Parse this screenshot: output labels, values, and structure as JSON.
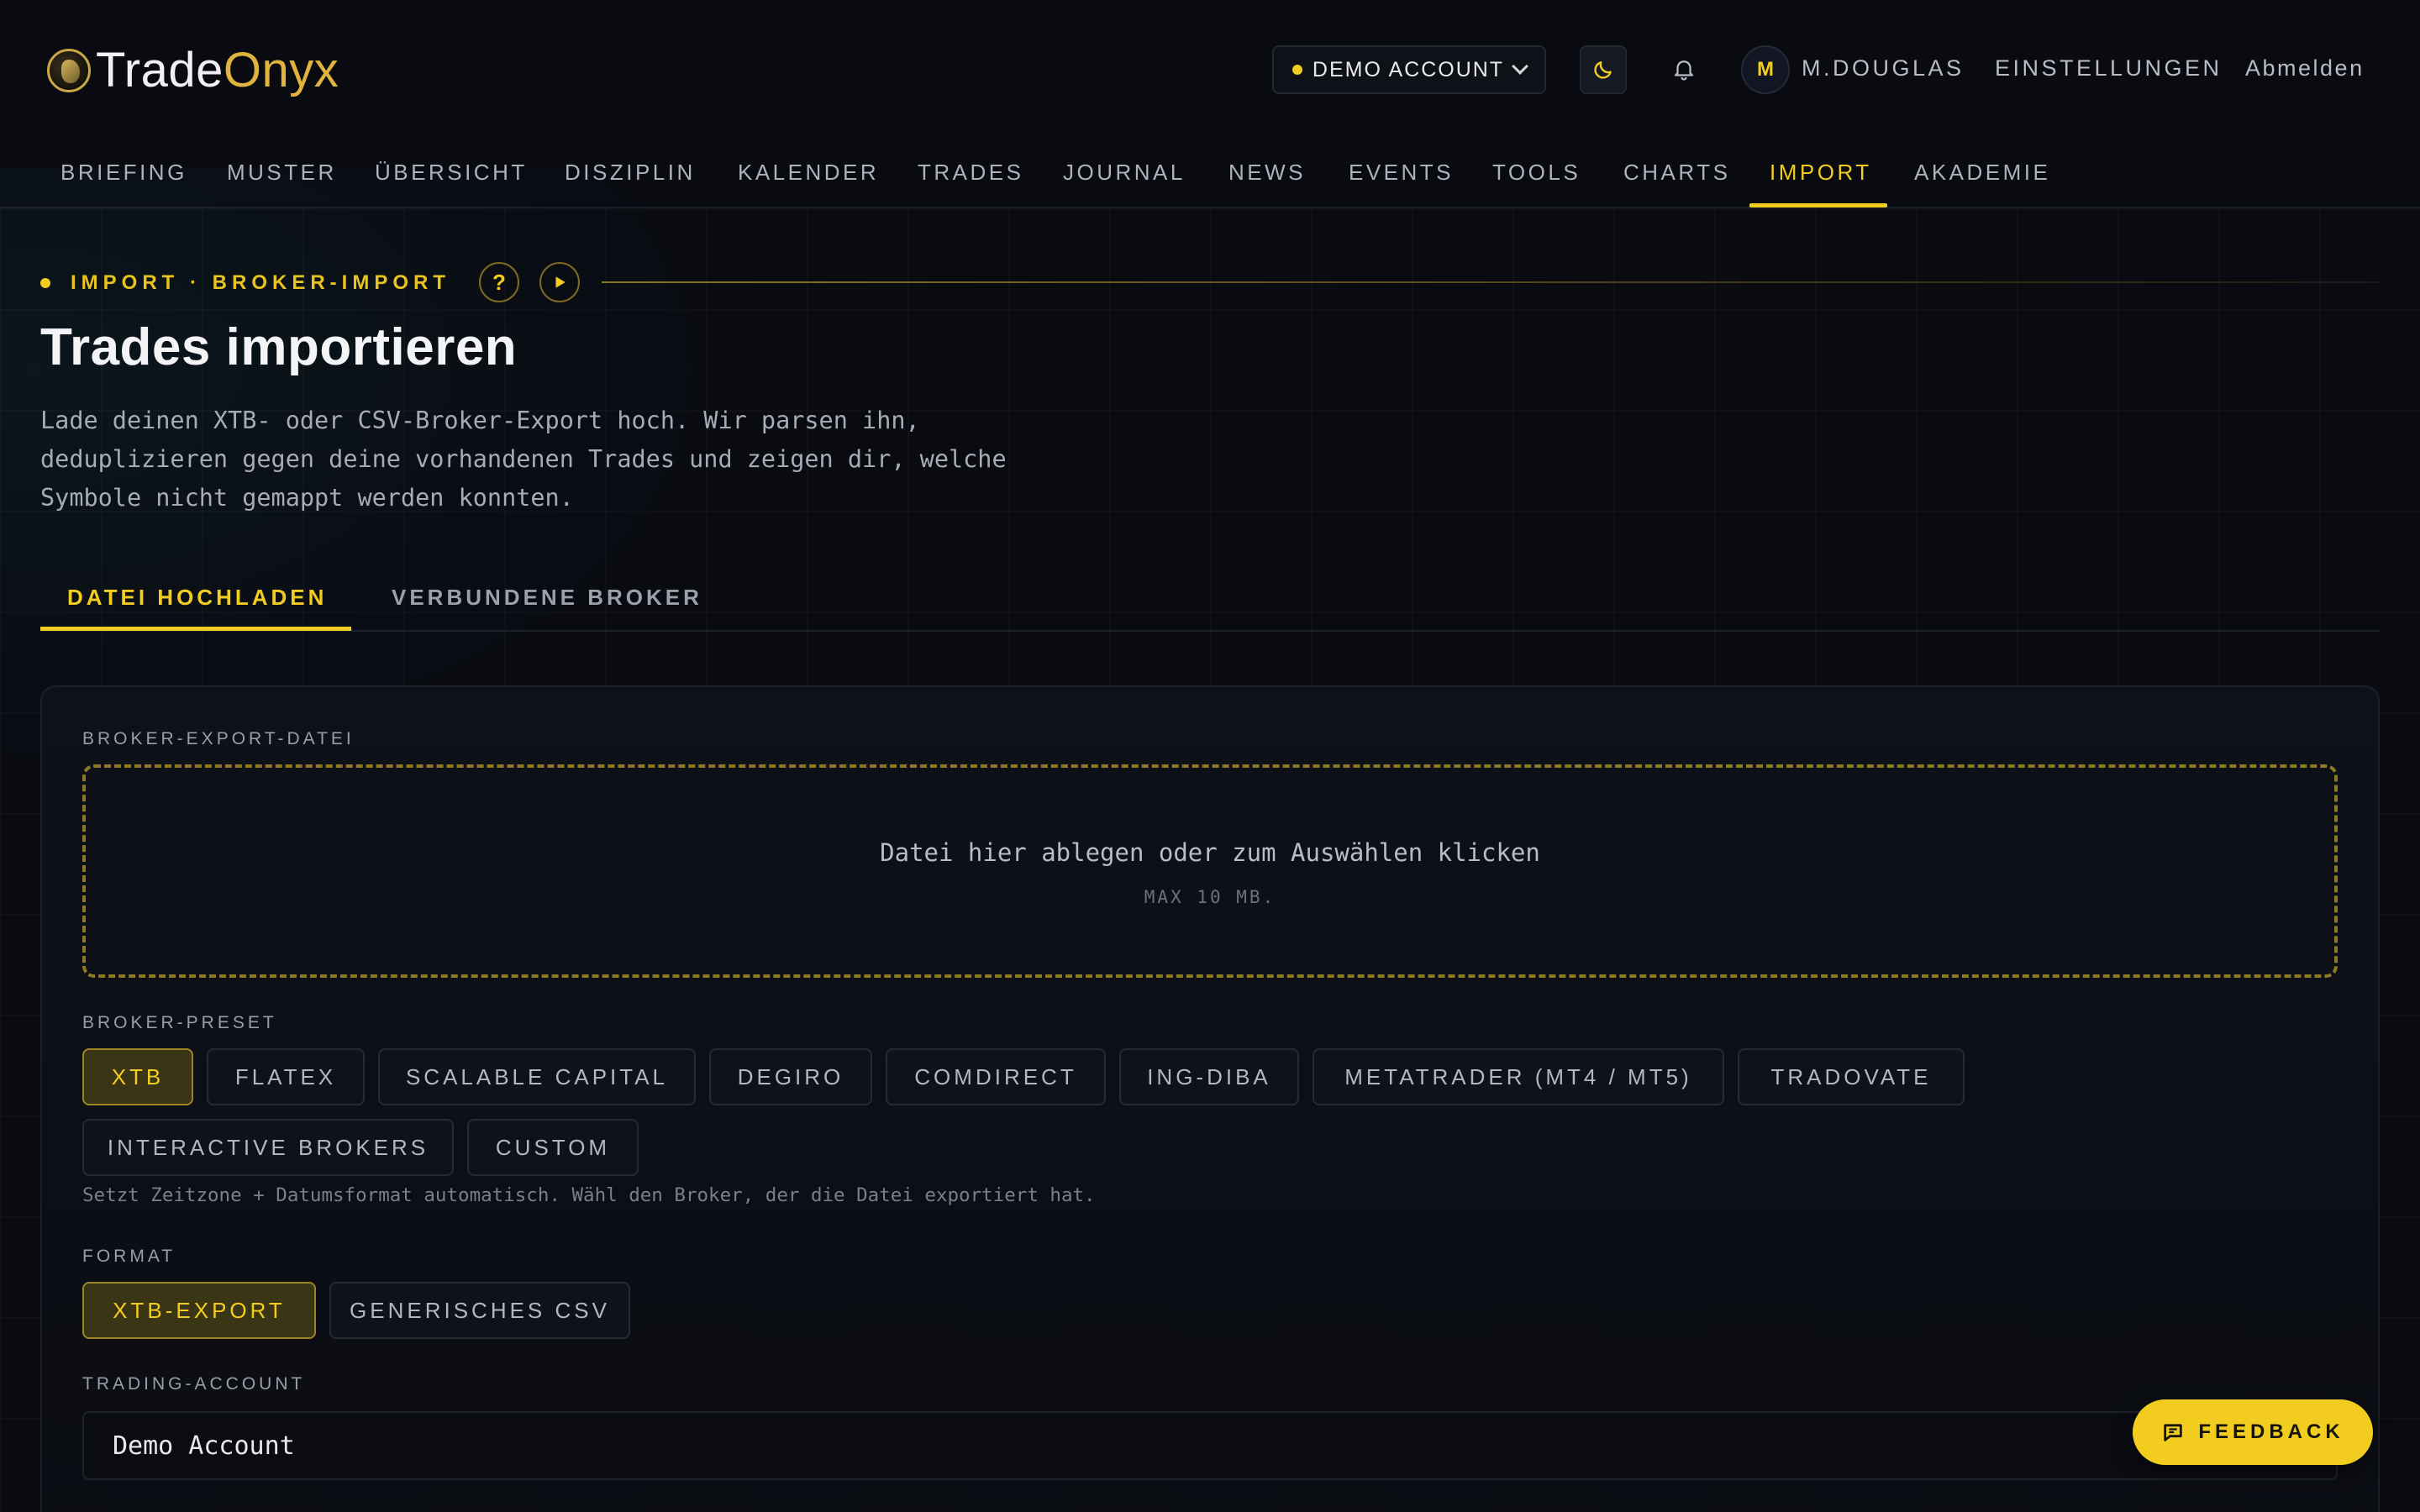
{
  "brand": {
    "name_part1": "Trade",
    "name_part2": "Onyx"
  },
  "header": {
    "account_selector": "DEMO ACCOUNT",
    "avatar_initial": "M",
    "user_name": "M.DOUGLAS",
    "settings_label": "EINSTELLUNGEN",
    "logout_label": "Abmelden"
  },
  "nav": {
    "items": [
      "BRIEFING",
      "MUSTER",
      "ÜBERSICHT",
      "DISZIPLIN",
      "KALENDER",
      "TRADES",
      "JOURNAL",
      "NEWS",
      "EVENTS",
      "TOOLS",
      "CHARTS",
      "IMPORT",
      "AKADEMIE"
    ],
    "active": "IMPORT"
  },
  "page": {
    "eyebrow": "IMPORT · BROKER-IMPORT",
    "help_label": "?",
    "title": "Trades importieren",
    "description_lines": [
      "Lade deinen XTB- oder CSV-Broker-Export hoch. Wir parsen ihn,",
      "deduplizieren gegen deine vorhandenen Trades und zeigen dir, welche",
      "Symbole nicht gemappt werden konnten."
    ]
  },
  "tabs": [
    {
      "label": "DATEI HOCHLADEN",
      "active": true
    },
    {
      "label": "VERBUNDENE BROKER",
      "active": false
    }
  ],
  "upload": {
    "file_label": "BROKER-EXPORT-DATEI",
    "drop_title": "Datei hier ablegen oder zum Auswählen klicken",
    "drop_sub": "MAX 10 MB."
  },
  "broker_preset": {
    "label": "BROKER-PRESET",
    "options": [
      "XTB",
      "FLATEX",
      "SCALABLE CAPITAL",
      "DEGIRO",
      "COMDIRECT",
      "ING-DIBA",
      "METATRADER (MT4 / MT5)",
      "TRADOVATE",
      "INTERACTIVE BROKERS",
      "CUSTOM"
    ],
    "selected": "XTB",
    "hint": "Setzt Zeitzone + Datumsformat automatisch. Wähl den Broker, der die Datei exportiert hat."
  },
  "format": {
    "label": "FORMAT",
    "options": [
      "XTB-EXPORT",
      "GENERISCHES CSV"
    ],
    "selected": "XTB-EXPORT"
  },
  "trading_account": {
    "label": "TRADING-ACCOUNT",
    "value": "Demo Account"
  },
  "feedback_label": "FEEDBACK",
  "colors": {
    "accent": "#f2cd1f",
    "background": "#090b11",
    "logo_accent": "#e0b43c"
  },
  "icons": {
    "theme": "moon-icon",
    "notifications": "bell-icon",
    "play": "play-icon",
    "feedback": "chat-bubble-icon"
  }
}
